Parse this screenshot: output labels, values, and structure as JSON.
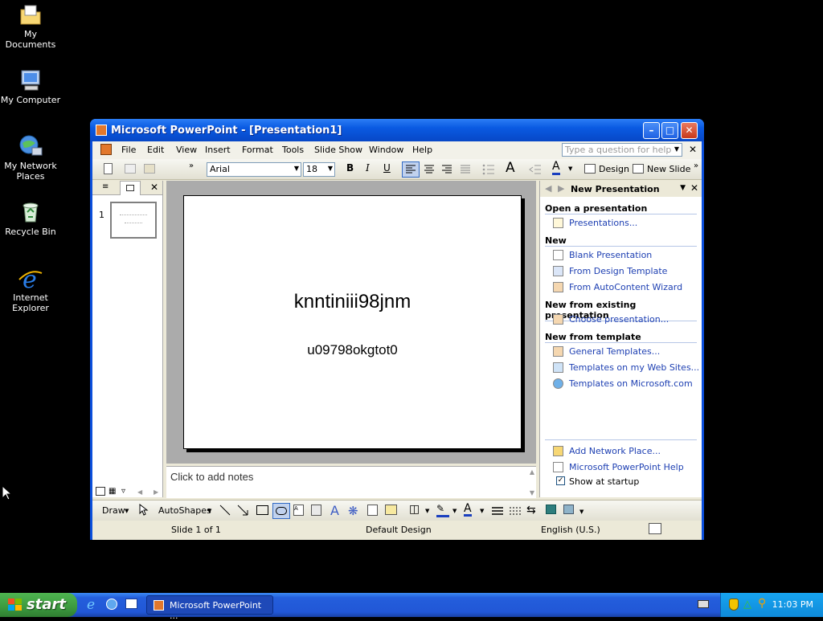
{
  "desktop": {
    "icons": [
      {
        "label": "My Documents"
      },
      {
        "label": "My Computer"
      },
      {
        "label": "My Network Places"
      },
      {
        "label": "Recycle Bin"
      },
      {
        "label": "Internet Explorer"
      }
    ]
  },
  "window": {
    "title": "Microsoft PowerPoint - [Presentation1]",
    "menu": [
      "File",
      "Edit",
      "View",
      "Insert",
      "Format",
      "Tools",
      "Slide Show",
      "Window",
      "Help"
    ],
    "help_placeholder": "Type a question for help",
    "toolbar": {
      "font": "Arial",
      "size": "18",
      "design_label": "Design",
      "new_slide_label": "New Slide"
    },
    "slides": [
      {
        "number": "1"
      }
    ],
    "slide": {
      "title": "knntiniii98jnm",
      "subtitle": "u09798okgtot0"
    },
    "notes_placeholder": "Click to add notes",
    "task_pane": {
      "title": "New Presentation",
      "sections": [
        {
          "heading": "Open a presentation",
          "links": [
            "Presentations..."
          ]
        },
        {
          "heading": "New",
          "links": [
            "Blank Presentation",
            "From Design Template",
            "From AutoContent Wizard"
          ]
        },
        {
          "heading": "New from existing presentation",
          "links": [
            "Choose presentation..."
          ]
        },
        {
          "heading": "New from template",
          "links": [
            "General Templates...",
            "Templates on my Web Sites...",
            "Templates on Microsoft.com"
          ]
        }
      ],
      "footer_links": [
        "Add Network Place...",
        "Microsoft PowerPoint Help"
      ],
      "show_at_startup": "Show at startup",
      "show_at_startup_checked": true
    },
    "drawbar": {
      "draw_label": "Draw",
      "autoshapes_label": "AutoShapes"
    },
    "status": {
      "slide": "Slide 1 of 1",
      "design": "Default Design",
      "language": "English (U.S.)"
    }
  },
  "taskbar": {
    "start_label": "start",
    "task_label": "Microsoft PowerPoint ...",
    "clock": "11:03 PM"
  }
}
